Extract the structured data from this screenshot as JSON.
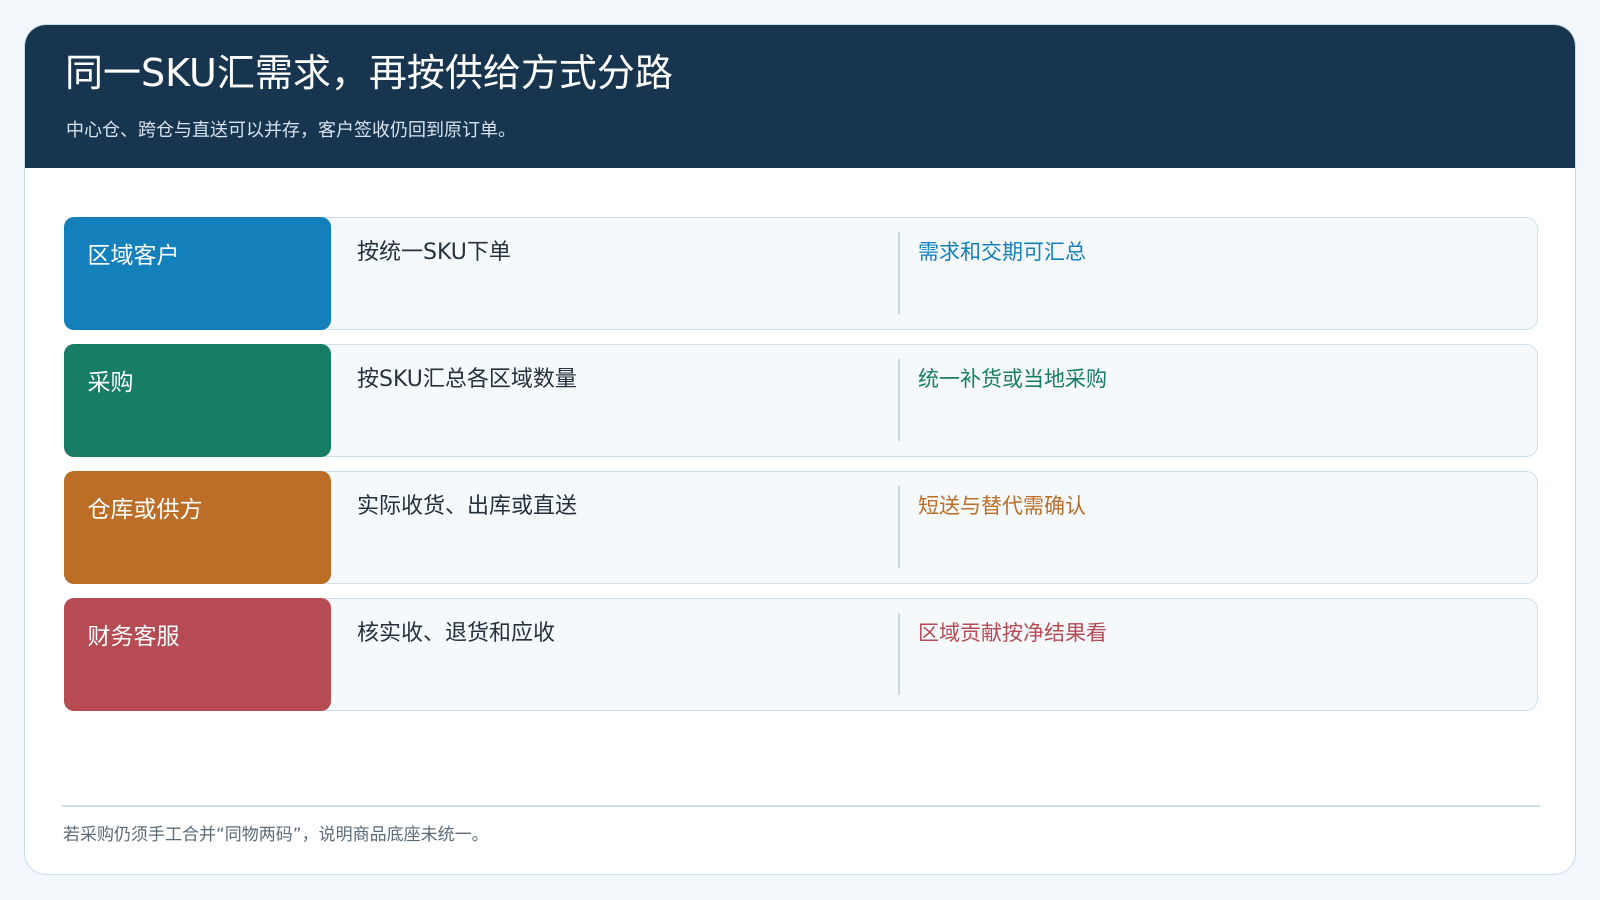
{
  "header": {
    "title": "同一SKU汇需求，再按供给方式分路",
    "subtitle": "中心仓、跨仓与直送可以并存，客户签收仍回到原订单。"
  },
  "rows": [
    {
      "role": "区域客户",
      "action": "按统一SKU下单",
      "outcome": "需求和交期可汇总",
      "color": "#1380bb"
    },
    {
      "role": "采购",
      "action": "按SKU汇总各区域数量",
      "outcome": "统一补货或当地采购",
      "color": "#177d64"
    },
    {
      "role": "仓库或供方",
      "action": "实际收货、出库或直送",
      "outcome": "短送与替代需确认",
      "color": "#bc6d26"
    },
    {
      "role": "财务客服",
      "action": "核实收、退货和应收",
      "outcome": "区域贡献按净结果看",
      "color": "#b64b53"
    }
  ],
  "footer": {
    "note": "若采购仍须手工合并“同物两码”，说明商品底座未统一。"
  }
}
